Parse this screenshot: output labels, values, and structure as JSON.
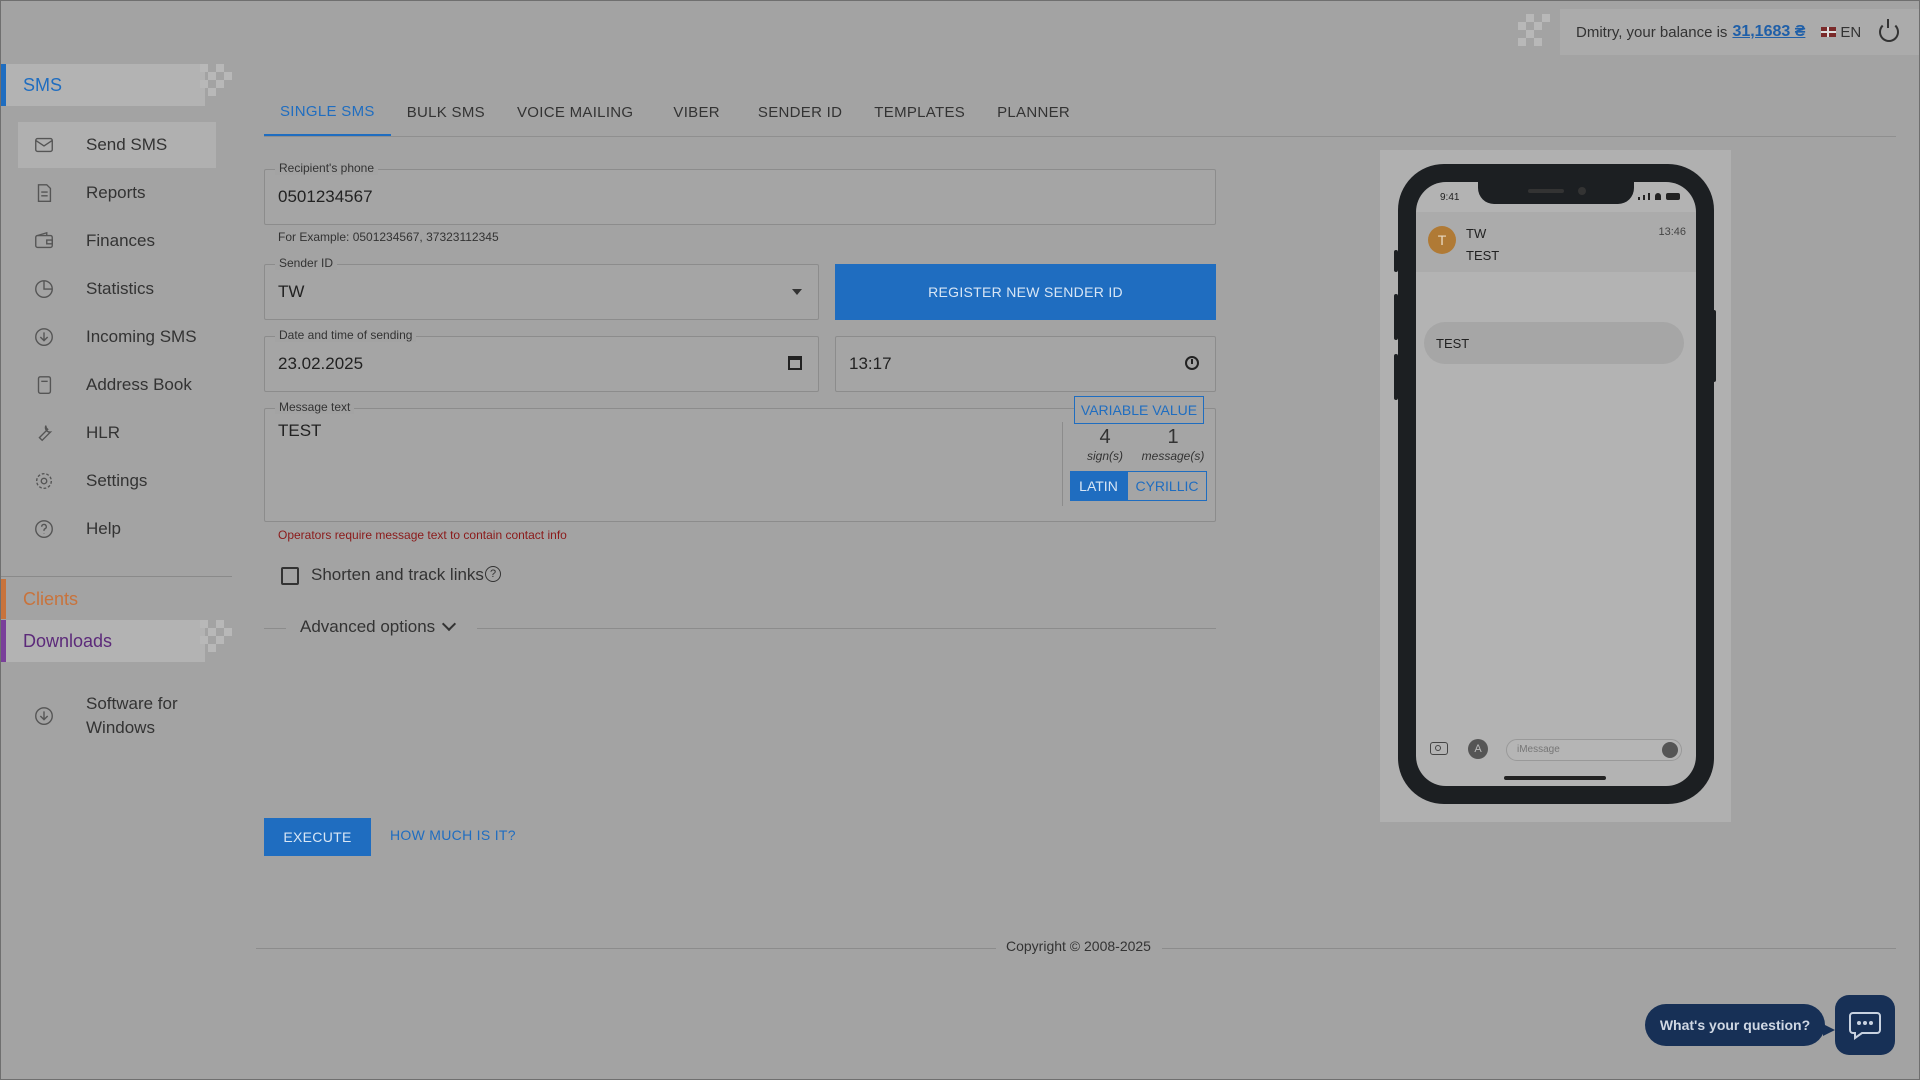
{
  "topbar": {
    "greeting": "Dmitry, your balance is",
    "balance": "31,1683 ₴",
    "language": "EN"
  },
  "sidebar": {
    "sms_section": "SMS",
    "items": [
      {
        "label": "Send SMS",
        "icon": "envelope-icon"
      },
      {
        "label": "Reports",
        "icon": "document-icon"
      },
      {
        "label": "Finances",
        "icon": "wallet-icon"
      },
      {
        "label": "Statistics",
        "icon": "pie-chart-icon"
      },
      {
        "label": "Incoming SMS",
        "icon": "download-circle-icon"
      },
      {
        "label": "Address Book",
        "icon": "book-icon"
      },
      {
        "label": "HLR",
        "icon": "wrench-icon"
      },
      {
        "label": "Settings",
        "icon": "gear-icon"
      },
      {
        "label": "Help",
        "icon": "question-circle-icon"
      }
    ],
    "clients_section": "Clients",
    "downloads_section": "Downloads",
    "software_line1": "Software for",
    "software_line2": "Windows"
  },
  "tabs": [
    "SINGLE SMS",
    "BULK SMS",
    "VOICE MAILING",
    "VIBER",
    "SENDER ID",
    "TEMPLATES",
    "PLANNER"
  ],
  "form": {
    "phone_label": "Recipient's phone",
    "phone_value": "0501234567",
    "phone_hint": "For Example: 0501234567, 37323112345",
    "sender_label": "Sender ID",
    "sender_value": "TW",
    "register_button": "REGISTER NEW SENDER ID",
    "date_label": "Date and time of sending",
    "date_value": "23.02.2025",
    "time_value": "13:17",
    "message_label": "Message text",
    "message_value": "TEST",
    "variable_button": "VARIABLE VALUE",
    "signs_count": "4",
    "signs_caption": "sign(s)",
    "messages_count": "1",
    "messages_caption": "message(s)",
    "latin": "LATIN",
    "cyrillic": "CYRILLIC",
    "error_text": "Operators require message text to contain contact info",
    "shorten_label": "Shorten and track links",
    "advanced_label": "Advanced options",
    "execute_button": "EXECUTE",
    "price_link": "HOW MUCH IS IT?"
  },
  "footer": {
    "copyright": "Copyright © 2008-2025"
  },
  "preview": {
    "status_time": "9:41",
    "sender_initial": "T",
    "sender_name": "TW",
    "preview_text": "TEST",
    "msg_time": "13:46",
    "bubble_text": "TEST",
    "input_placeholder": "iMessage"
  },
  "chat": {
    "question": "What's your question?"
  },
  "colors": {
    "accent": "#1f6dc0",
    "clients": "#c8733c",
    "downloads": "#7a3f9a",
    "chat": "#173056",
    "error": "#8b1a1a"
  }
}
